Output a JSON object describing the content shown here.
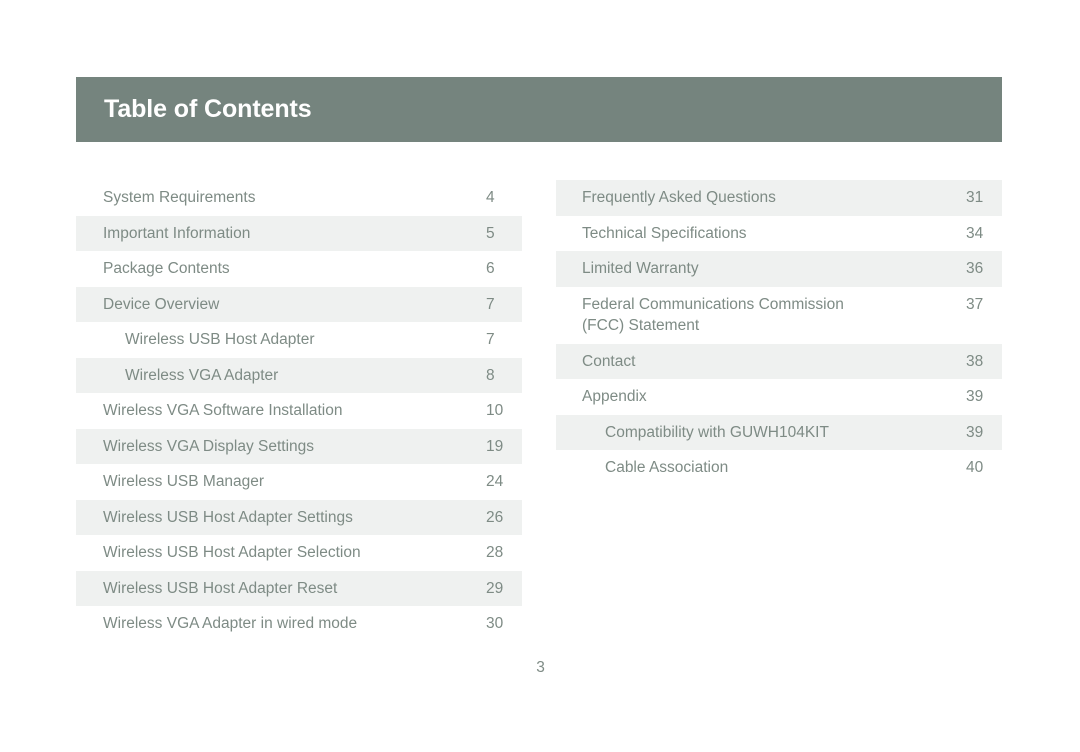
{
  "header": {
    "title": "Table of Contents",
    "background_color": "#75847e",
    "text_color": "#ffffff"
  },
  "theme": {
    "text_color": "#7e8b85",
    "stripe_color": "#eff1f0",
    "page_background": "#ffffff"
  },
  "footer": {
    "page_number": "3"
  },
  "toc": {
    "left_column": [
      {
        "label": "System Requirements",
        "page": "4",
        "indent": false,
        "striped": false
      },
      {
        "label": "Important Information",
        "page": "5",
        "indent": false,
        "striped": true
      },
      {
        "label": "Package Contents",
        "page": "6",
        "indent": false,
        "striped": false
      },
      {
        "label": "Device Overview",
        "page": "7",
        "indent": false,
        "striped": true
      },
      {
        "label": "Wireless USB Host Adapter",
        "page": "7",
        "indent": true,
        "striped": false
      },
      {
        "label": "Wireless VGA Adapter",
        "page": "8",
        "indent": true,
        "striped": true
      },
      {
        "label": "Wireless VGA Software Installation",
        "page": "10",
        "indent": false,
        "striped": false
      },
      {
        "label": "Wireless VGA Display Settings",
        "page": "19",
        "indent": false,
        "striped": true
      },
      {
        "label": "Wireless USB Manager",
        "page": "24",
        "indent": false,
        "striped": false
      },
      {
        "label": "Wireless USB Host Adapter Settings",
        "page": "26",
        "indent": false,
        "striped": true
      },
      {
        "label": "Wireless USB Host Adapter Selection",
        "page": "28",
        "indent": false,
        "striped": false
      },
      {
        "label": "Wireless USB Host Adapter Reset",
        "page": "29",
        "indent": false,
        "striped": true
      },
      {
        "label": "Wireless VGA Adapter in wired mode",
        "page": "30",
        "indent": false,
        "striped": false
      }
    ],
    "right_column": [
      {
        "label": "Frequently Asked Questions",
        "page": "31",
        "indent": false,
        "striped": true
      },
      {
        "label": "Technical Specifications",
        "page": "34",
        "indent": false,
        "striped": false
      },
      {
        "label": "Limited Warranty",
        "page": "36",
        "indent": false,
        "striped": true
      },
      {
        "label": "Federal Communications Commission\n(FCC) Statement",
        "page": "37",
        "indent": false,
        "striped": false
      },
      {
        "label": "Contact",
        "page": "38",
        "indent": false,
        "striped": true
      },
      {
        "label": "Appendix",
        "page": "39",
        "indent": false,
        "striped": false
      },
      {
        "label": "Compatibility with GUWH104KIT",
        "page": "39",
        "indent": true,
        "striped": true
      },
      {
        "label": "Cable Association",
        "page": "40",
        "indent": true,
        "striped": false
      }
    ]
  }
}
